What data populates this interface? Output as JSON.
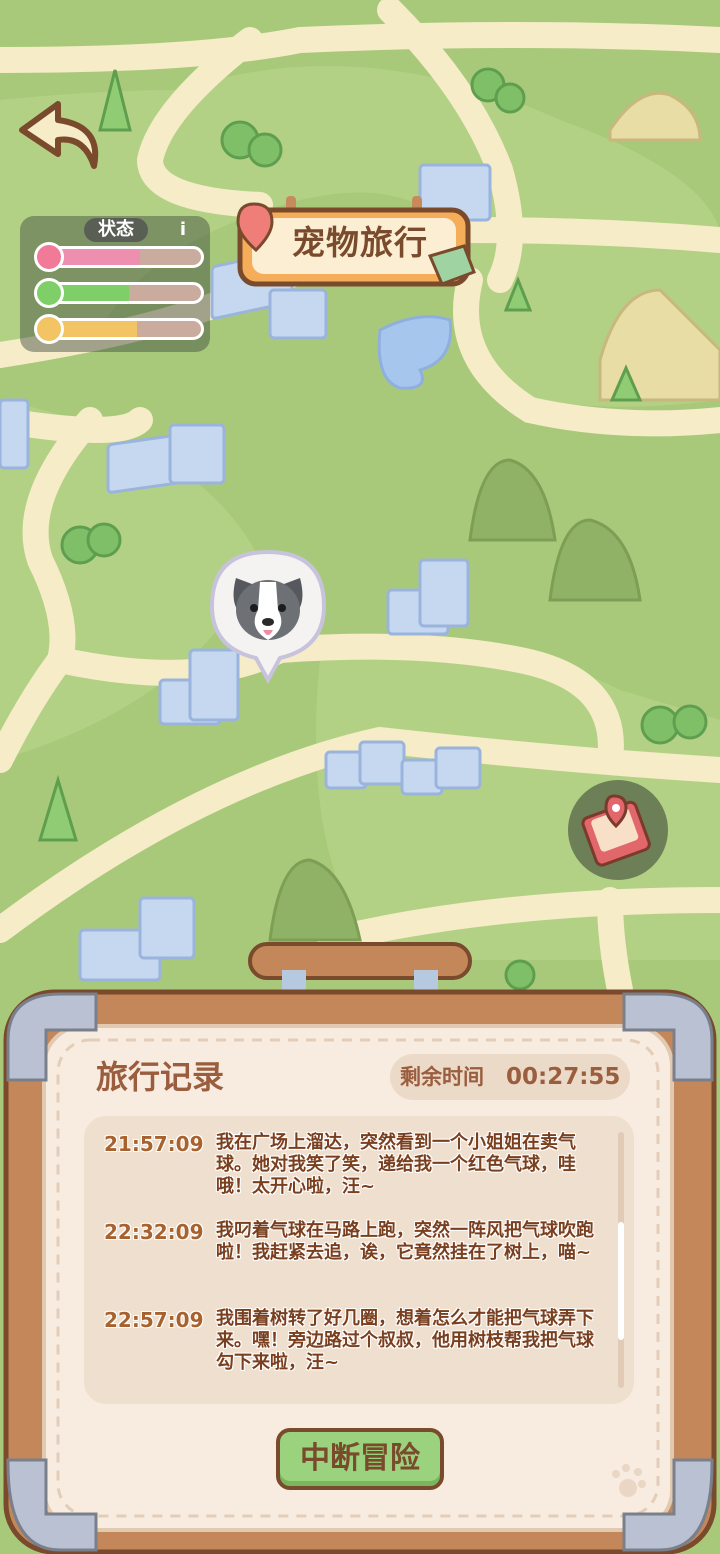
{
  "header": {
    "title": "宠物旅行"
  },
  "status": {
    "label": "状态",
    "info": "i",
    "bars": [
      {
        "name": "health",
        "icon": "heart-icon",
        "level": 0.62,
        "color": "#ef8fb0"
      },
      {
        "name": "hunger",
        "icon": "food-bowl-icon",
        "level": 0.55,
        "color": "#7fcf68"
      },
      {
        "name": "energy",
        "icon": "lightning-icon",
        "level": 0.6,
        "color": "#f2c463"
      }
    ]
  },
  "travel_log": {
    "title": "旅行记录",
    "timer_label": "剩余时间",
    "timer_value": "00:27:55",
    "entries": [
      {
        "time": "21:57:09",
        "text": "我在广场上溜达，突然看到一个小姐姐在卖气球。她对我笑了笑，递给我一个红色气球，哇哦！太开心啦，汪~"
      },
      {
        "time": "22:32:09",
        "text": "我叼着气球在马路上跑，突然一阵风把气球吹跑啦！我赶紧去追，诶，它竟然挂在了树上，喵~"
      },
      {
        "time": "22:57:09",
        "text": "我围着树转了好几圈，想着怎么才能把气球弄下来。嘿！旁边路过个叔叔，他用树枝帮我把气球勾下来啦，汪~"
      }
    ],
    "abort_button": "中断冒险"
  },
  "colors": {
    "map_green": "#a8c97a",
    "road": "#f6ecc8",
    "suitcase_brown": "#c4875a",
    "panel_cream": "#f8ece0",
    "text_brown": "#7a4a2c"
  }
}
